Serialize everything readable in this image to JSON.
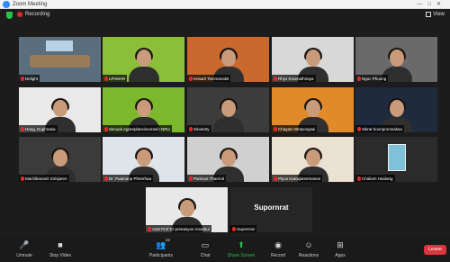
{
  "window": {
    "title": "Zoom Meeting"
  },
  "infobar": {
    "recording_label": "Recording",
    "view_label": "View"
  },
  "tiles": [
    {
      "name": "Delight",
      "bg": "#5a6e7e",
      "kind": "room",
      "active": true
    },
    {
      "name": "LPAMAR",
      "bg": "#8bbf3a",
      "kind": "person"
    },
    {
      "name": "Krisadi Tienmanakit",
      "bg": "#c9692e",
      "kind": "person"
    },
    {
      "name": "Rhys Kruenathiraya",
      "bg": "#d8d8d8",
      "kind": "person"
    },
    {
      "name": "Ngoc Phuong",
      "bg": "#6a6a6a",
      "kind": "person"
    },
    {
      "name": "Hong, Euphrasia",
      "bg": "#e9e9e9",
      "kind": "person"
    },
    {
      "name": "Simuek Agreeplansinsorasin NRU",
      "bg": "#7bb82c",
      "kind": "person"
    },
    {
      "name": "Sinoenty",
      "bg": "#3c3c3c",
      "kind": "person"
    },
    {
      "name": "Chayam Wutyongsai",
      "bg": "#e08a2a",
      "kind": "person"
    },
    {
      "name": "Sitirat boonpromsaksa",
      "bg": "#1f2a3c",
      "kind": "person"
    },
    {
      "name": "Machikananit Sirisjaren",
      "bg": "#3b3b3b",
      "kind": "person"
    },
    {
      "name": "Dr. Puamanp Pheerhaa",
      "bg": "#dfe3ea",
      "kind": "person"
    },
    {
      "name": "Parinsut Tharnnit",
      "bg": "#d0d0d0",
      "kind": "person"
    },
    {
      "name": "Piyus Kaewjareemanee",
      "bg": "#ece2d4",
      "kind": "person"
    },
    {
      "name": "Chaliam Hanlang",
      "bg": "#2b2b2b",
      "kind": "photo"
    },
    {
      "name": "Asst Prof Dr preeasyon Anunkul",
      "bg": "#e8e8e8",
      "kind": "person"
    },
    {
      "name": "Supornrat",
      "big": "Supornrat",
      "bg": "#262626",
      "kind": "name-only"
    }
  ],
  "toolbar": {
    "unmute": "Unmute",
    "stop_video": "Stop Video",
    "participants": "Participants",
    "participants_count": "22",
    "chat": "Chat",
    "share_screen": "Share Screen",
    "record": "Record",
    "reactions": "Reactions",
    "apps": "Apps",
    "leave": "Leave"
  }
}
